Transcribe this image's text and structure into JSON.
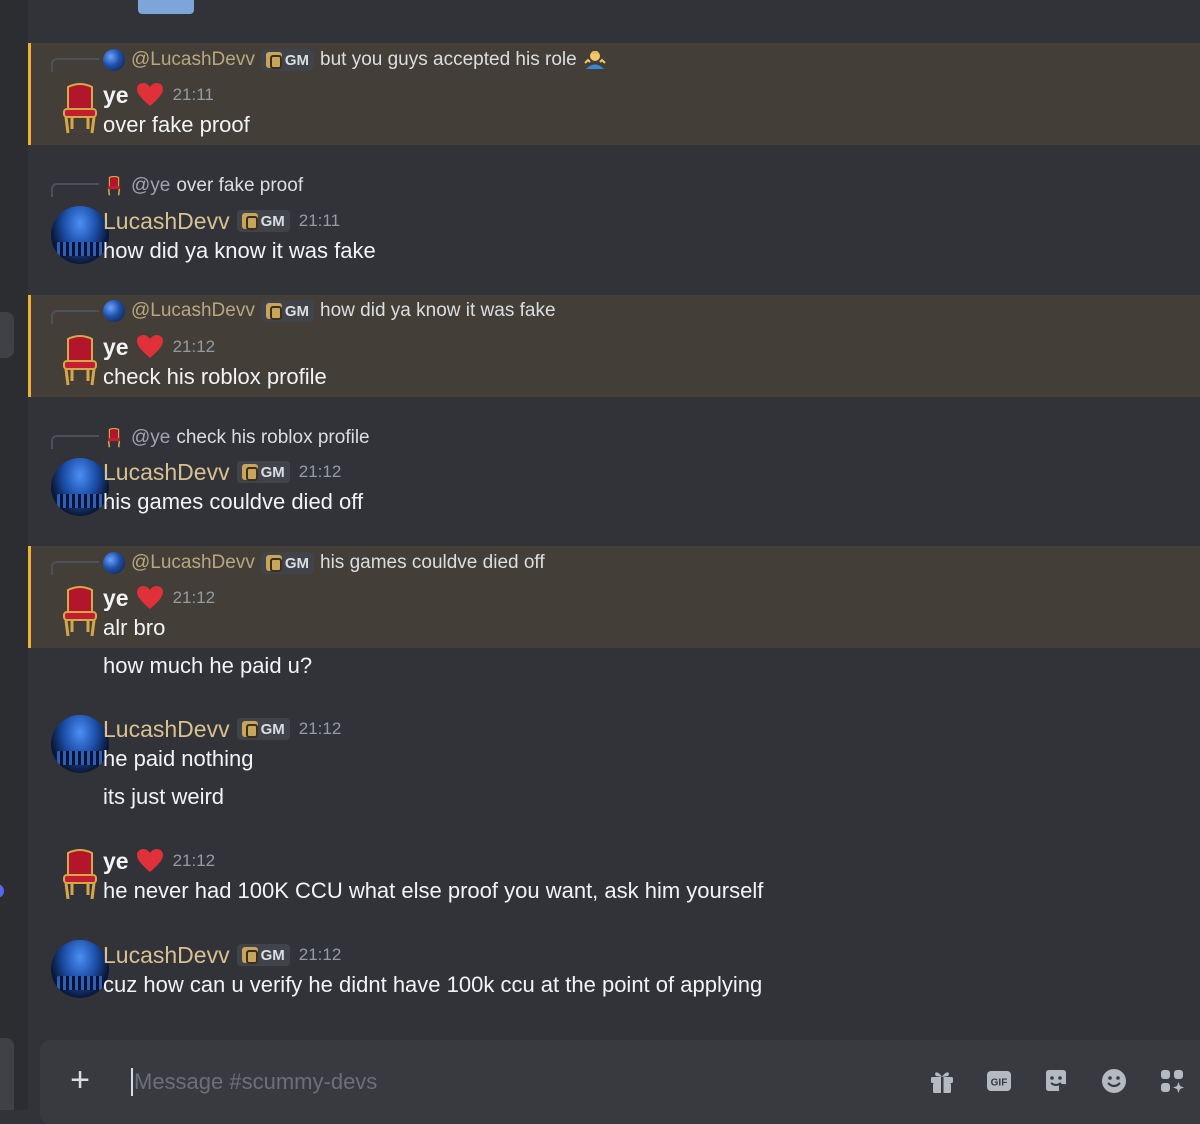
{
  "messages": [
    {
      "reply": {
        "author": "@LucashDevv",
        "tag": "GM",
        "text": "but you guys accepted his role"
      },
      "author": "ye",
      "time": "21:11",
      "lines": [
        "over fake proof"
      ]
    },
    {
      "reply": {
        "author": "@ye",
        "text": "over fake proof"
      },
      "author": "LucashDevv",
      "tag": "GM",
      "time": "21:11",
      "lines": [
        "how did ya know it was fake"
      ]
    },
    {
      "reply": {
        "author": "@LucashDevv",
        "tag": "GM",
        "text": "how did ya know it was fake"
      },
      "author": "ye",
      "time": "21:12",
      "lines": [
        "check his roblox profile"
      ]
    },
    {
      "reply": {
        "author": "@ye",
        "text": "check his roblox profile"
      },
      "author": "LucashDevv",
      "tag": "GM",
      "time": "21:12",
      "lines": [
        "his games couldve died off"
      ]
    },
    {
      "reply": {
        "author": "@LucashDevv",
        "tag": "GM",
        "text": "his games couldve died off"
      },
      "author": "ye",
      "time": "21:12",
      "lines": [
        "alr bro",
        "how much he paid u?"
      ]
    },
    {
      "author": "LucashDevv",
      "tag": "GM",
      "time": "21:12",
      "lines": [
        "he paid nothing",
        "its just weird"
      ]
    },
    {
      "author": "ye",
      "time": "21:12",
      "lines": [
        "he never had 100K CCU what else proof you want, ask him yourself"
      ]
    },
    {
      "author": "LucashDevv",
      "tag": "GM",
      "time": "21:12",
      "lines": [
        "cuz how can u verify he didnt have 100k ccu at the point of applying"
      ]
    }
  ],
  "composer": {
    "placeholder": "Message #scummy-devs",
    "add_label": "+",
    "gif_label": "GIF"
  },
  "icons": {
    "reply_shrug": "person-shrugging-icon",
    "heart": "red-heart-icon",
    "throne": "throne-icon",
    "gift": "gift-icon",
    "gif": "gif-icon",
    "sticker": "sticker-icon",
    "emoji": "emoji-icon",
    "apps": "apps-icon"
  },
  "colors": {
    "background": "#323339",
    "mention_bg": "#433e37",
    "mention_border": "#f0b232",
    "lucash_name": "#d8c190",
    "heart": "#e0303a"
  }
}
